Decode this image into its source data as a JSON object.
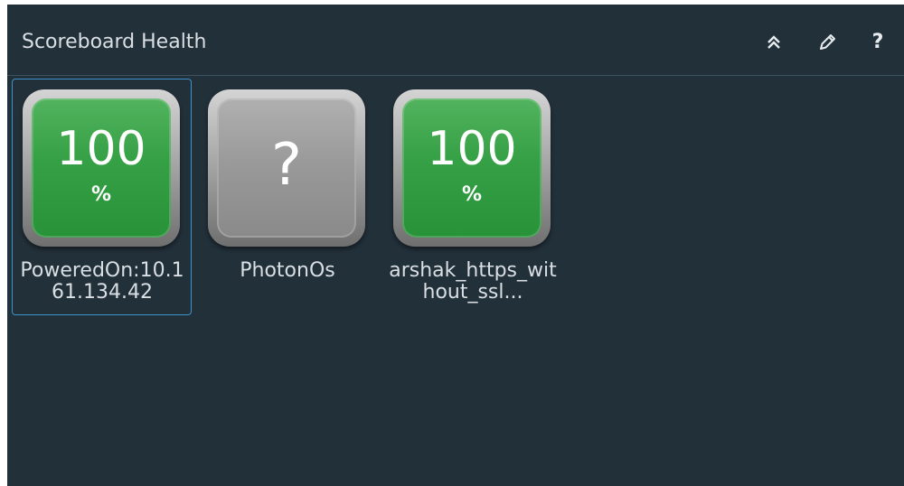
{
  "widget": {
    "title": "Scoreboard Health",
    "help_label": "?"
  },
  "tiles": [
    {
      "label": "PoweredOn:10.161.134.42",
      "value": "100",
      "unit": "%",
      "status": "green",
      "selected": true
    },
    {
      "label": "PhotonOs",
      "value": "?",
      "status": "unknown",
      "selected": false
    },
    {
      "label": "arshak_https_without_ssl...",
      "value": "100",
      "unit": "%",
      "status": "green",
      "selected": false
    }
  ],
  "colors": {
    "panel_bg": "#22303a",
    "green": "#35a045",
    "grey": "#989898",
    "selection": "#3b93c9"
  }
}
